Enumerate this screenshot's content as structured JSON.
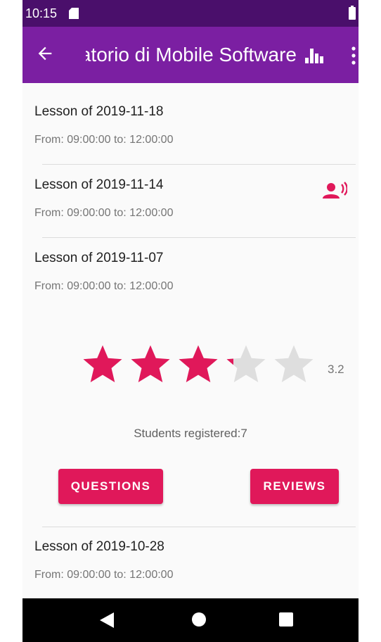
{
  "status_bar": {
    "time": "10:15"
  },
  "app_bar": {
    "title": "Laboratorio di Mobile Software"
  },
  "lessons": [
    {
      "title": "Lesson of 2019-11-18",
      "time": "From: 09:00:00 to: 12:00:00"
    },
    {
      "title": "Lesson of 2019-11-14",
      "time": "From: 09:00:00 to: 12:00:00"
    },
    {
      "title": "Lesson of 2019-11-07",
      "time": "From: 09:00:00 to: 12:00:00"
    },
    {
      "title": "Lesson of 2019-10-28",
      "time": "From: 09:00:00 to: 12:00:00"
    }
  ],
  "expanded": {
    "rating": 3.2,
    "rating_label": "3.2",
    "stars_total": 5,
    "students": "Students registered:7",
    "questions_label": "QUESTIONS",
    "reviews_label": "REVIEWS"
  },
  "colors": {
    "status_bar": "#4a0f6b",
    "app_bar": "#7b1fa2",
    "accent": "#e0185a",
    "star_empty": "#dedede"
  },
  "icons": [
    "back-arrow-icon",
    "bar-chart-icon",
    "overflow-menu-icon",
    "speaker-icon",
    "sd-card-icon",
    "battery-icon",
    "nav-back-icon",
    "nav-home-icon",
    "nav-recents-icon"
  ]
}
